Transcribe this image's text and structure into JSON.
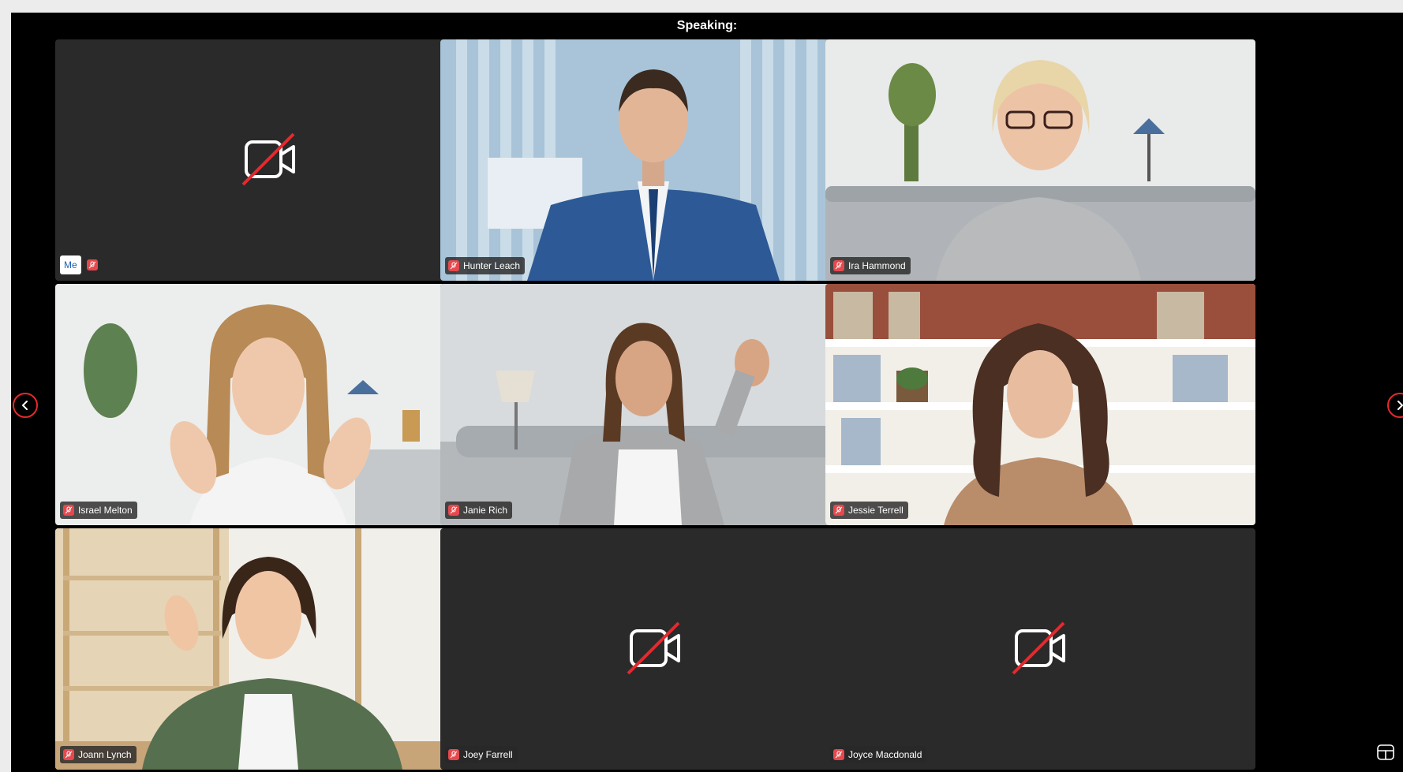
{
  "header": {
    "speaking_label": "Speaking:"
  },
  "self": {
    "label": "Me",
    "mic_muted": true,
    "camera_off": true
  },
  "participants": [
    {
      "name": "Hunter Leach",
      "mic_muted": true,
      "camera_off": false
    },
    {
      "name": "Ira Hammond",
      "mic_muted": true,
      "camera_off": false
    },
    {
      "name": "Israel Melton",
      "mic_muted": true,
      "camera_off": false
    },
    {
      "name": "Janie Rich",
      "mic_muted": true,
      "camera_off": false
    },
    {
      "name": "Jessie Terrell",
      "mic_muted": true,
      "camera_off": false
    },
    {
      "name": "Joann Lynch",
      "mic_muted": true,
      "camera_off": false
    },
    {
      "name": "Joey Farrell",
      "mic_muted": true,
      "camera_off": true
    },
    {
      "name": "Joyce Macdonald",
      "mic_muted": true,
      "camera_off": true
    }
  ],
  "controls": {
    "prev_page_icon": "chevron-left-icon",
    "next_page_icon": "chevron-right-icon",
    "layout_icon": "layout-grid-icon"
  },
  "colors": {
    "accent": "#e5292d",
    "mic_muted": "#e5494d",
    "tile_bg": "#2a2a2a",
    "background": "#000000"
  }
}
